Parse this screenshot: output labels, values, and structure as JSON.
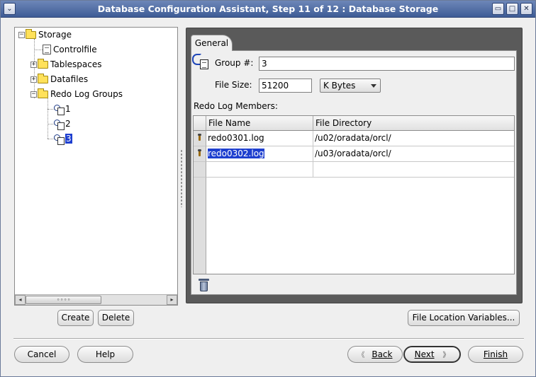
{
  "window": {
    "title": "Database Configuration Assistant, Step 11 of 12 : Database Storage",
    "controls": {
      "menu": "⌄",
      "minimize": "▭",
      "maximize": "□",
      "close": "✕"
    }
  },
  "tree": {
    "root": "Storage",
    "items": [
      {
        "label": "Controlfile"
      },
      {
        "label": "Tablespaces"
      },
      {
        "label": "Datafiles"
      },
      {
        "label": "Redo Log Groups"
      },
      {
        "label": "1"
      },
      {
        "label": "2"
      },
      {
        "label": "3"
      }
    ],
    "expanded_glyph": "−",
    "collapsed_glyph": "+",
    "scroll_left": "◂",
    "scroll_right": "▸",
    "scroll_grip": "∘∘∘∘"
  },
  "tree_buttons": {
    "create": "Create",
    "delete": "Delete"
  },
  "general_tab": {
    "tab_label": "General",
    "group_label": "Group #:",
    "group_value": "3",
    "file_size_label": "File Size:",
    "file_size_value": "51200",
    "unit_selected": "K Bytes",
    "members_label": "Redo Log Members:",
    "columns": [
      "File Name",
      "File Directory"
    ],
    "rows": [
      {
        "file_name": "redo0301.log",
        "file_directory": "/u02/oradata/orcl/"
      },
      {
        "file_name": "redo0302.log",
        "file_directory": "/u03/oradata/orcl/"
      },
      {
        "file_name": "",
        "file_directory": ""
      }
    ]
  },
  "file_location_button": "File Location Variables...",
  "footer": {
    "cancel": "Cancel",
    "help": "Help",
    "back": "Back",
    "next": "Next",
    "finish": "Finish",
    "back_glyph": "《",
    "next_glyph": "》"
  },
  "colors": {
    "selection": "#1e3fcf",
    "titlebar": "#4f6aa3"
  }
}
